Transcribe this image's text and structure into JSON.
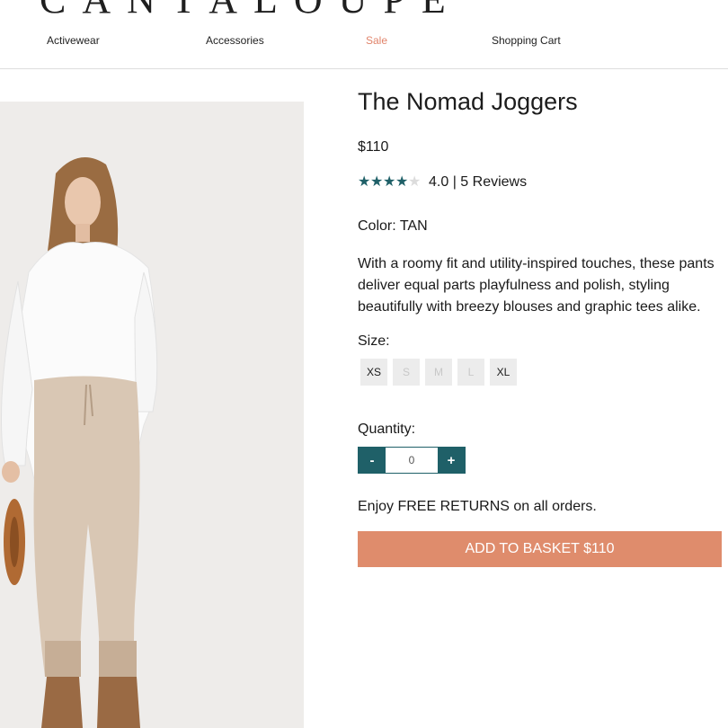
{
  "brand": {
    "logo_text": "CANTALOUPE"
  },
  "nav": {
    "items": [
      {
        "label": "Activewear"
      },
      {
        "label": "Accessories"
      },
      {
        "label": "Sale"
      },
      {
        "label": "Shopping Cart"
      }
    ]
  },
  "product": {
    "title": "The Nomad Joggers",
    "price": "$110",
    "rating": {
      "value": 4.0,
      "max": 5,
      "text": "4.0 | 5 Reviews"
    },
    "color_line": "Color: TAN",
    "description": "With a roomy fit and utility-inspired touches, these pants deliver equal parts playfulness and polish, styling beautifully with breezy blouses and graphic tees alike.",
    "size_label": "Size:",
    "sizes": [
      {
        "label": "XS",
        "available": true
      },
      {
        "label": "S",
        "available": false
      },
      {
        "label": "M",
        "available": false
      },
      {
        "label": "L",
        "available": false
      },
      {
        "label": "XL",
        "available": true
      }
    ],
    "quantity_label": "Quantity:",
    "quantity": {
      "decrement": "-",
      "value": "0",
      "increment": "+"
    },
    "returns_text": "Enjoy FREE RETURNS on all orders.",
    "add_button": "ADD TO BASKET $110"
  },
  "colors": {
    "accent_teal": "#1f6068",
    "sale": "#e1846b",
    "cta": "#df8c6c"
  },
  "icons": {
    "star_filled": "star-icon",
    "star_empty": "star-empty-icon"
  }
}
